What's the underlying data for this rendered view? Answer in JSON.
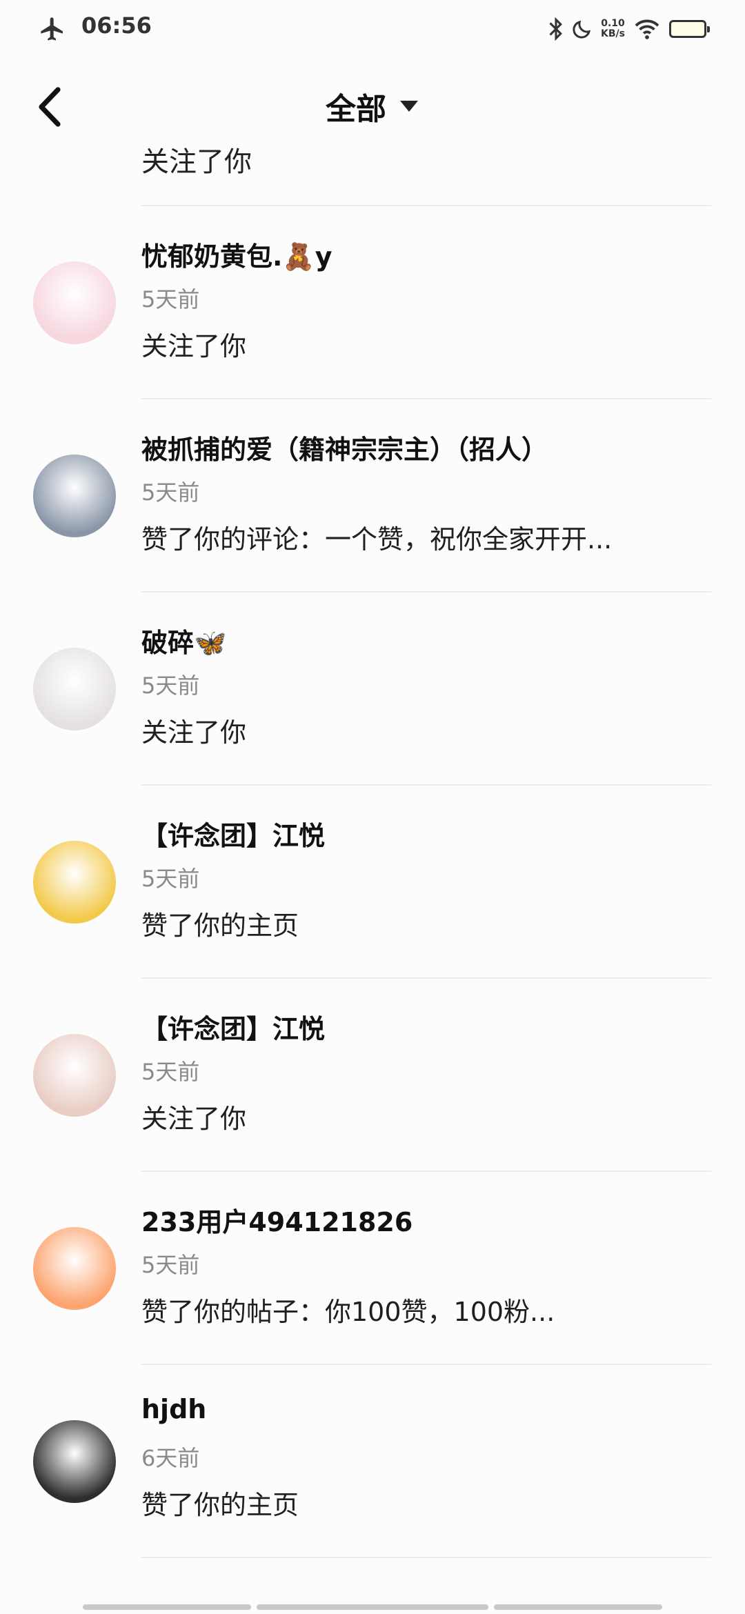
{
  "status_bar": {
    "time": "06:56",
    "net_speed_value": "0.10",
    "net_speed_unit": "KB/s",
    "icons": [
      "airplane-icon",
      "bluetooth-icon",
      "moon-icon",
      "wifi-icon",
      "battery-icon"
    ]
  },
  "nav": {
    "title": "全部",
    "back_icon": "chevron-left-icon",
    "dropdown_icon": "caret-down-icon"
  },
  "top_partial": {
    "action": "关注了你"
  },
  "notifications": [
    {
      "name": "忧郁奶黄包.🧸y",
      "time": "5天前",
      "action": "关注了你",
      "avatar_color": "#f7d6de"
    },
    {
      "name": "被抓捕的爱（籍神宗宗主）（招人）",
      "time": "5天前",
      "action": "赞了你的评论：一个赞，祝你全家开开...",
      "avatar_color": "#8a96a8"
    },
    {
      "name": "破碎🦋",
      "time": "5天前",
      "action": "关注了你",
      "avatar_color": "#e4e0e4"
    },
    {
      "name": "【许念团】江悦",
      "time": "5天前",
      "action": "赞了你的主页",
      "avatar_color": "#f3c94a"
    },
    {
      "name": "【许念团】江悦",
      "time": "5天前",
      "action": "关注了你",
      "avatar_color": "#e9ccc4"
    },
    {
      "name": "233用户494121826",
      "time": "5天前",
      "action": "赞了你的帖子：你100赞，100粉...",
      "avatar_color": "#fca36e"
    },
    {
      "name": "hjdh",
      "time": "6天前",
      "action": "赞了你的主页",
      "avatar_color": "#2e2e2e"
    }
  ]
}
